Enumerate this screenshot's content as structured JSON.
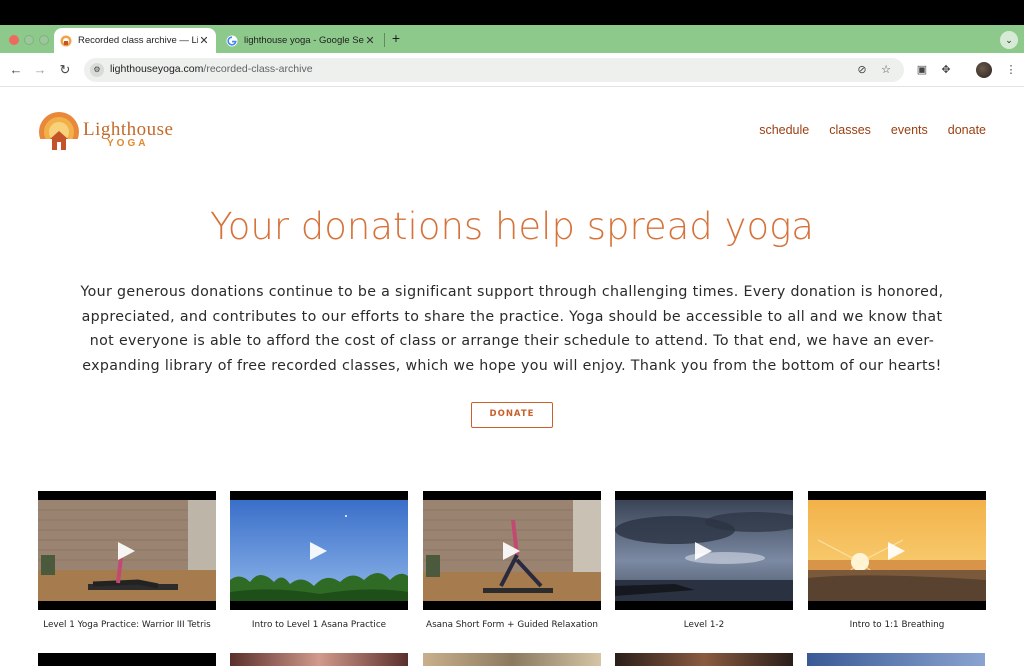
{
  "browser": {
    "tabs": [
      {
        "title": "Recorded class archive — Lig",
        "active": true
      },
      {
        "title": "lighthouse yoga - Google Sea",
        "active": false
      }
    ],
    "url_host": "lighthouseyoga.com",
    "url_path": "/recorded-class-archive"
  },
  "site": {
    "logo_line1": "Lighthouse",
    "logo_line2": "YOGA",
    "nav": [
      "schedule",
      "classes",
      "events",
      "donate"
    ]
  },
  "hero": {
    "title": "Your donations help spread yoga",
    "body": "Your generous donations continue to be a significant support through challenging times. Every donation is honored, appreciated, and contributes to our efforts to share the practice. Yoga should be accessible to all and we know that not everyone is able to afford the cost of class or arrange their schedule to attend. To that end, we have an ever-expanding library of free recorded classes, which we hope you will enjoy. Thank you from the bottom of our hearts!",
    "button": "DONATE"
  },
  "videos": [
    {
      "caption": "Level 1 Yoga Practice: Warrior III Tetris"
    },
    {
      "caption": "Intro to Level 1 Asana Practice"
    },
    {
      "caption": "Asana Short Form + Guided Relaxation"
    },
    {
      "caption": "Level 1-2"
    },
    {
      "caption": "Intro to 1:1 Breathing"
    }
  ],
  "colors": {
    "accent": "#c9602b",
    "nav": "#9a3f12",
    "title": "#d6723a",
    "tabstrip": "#8ec98c"
  }
}
